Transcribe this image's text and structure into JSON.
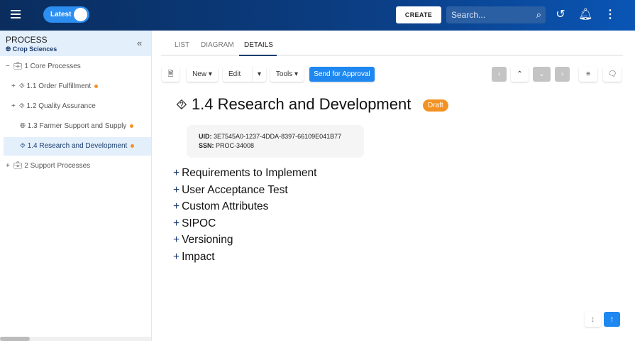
{
  "header": {
    "toggle_label": "Latest",
    "create_label": "CREATE",
    "search_placeholder": "Search..."
  },
  "sidebar": {
    "title": "PROCESS",
    "subtitle": "Crop Sciences",
    "items": [
      {
        "label": "1 Core Processes",
        "expander": "−",
        "icon": "briefcase-icon",
        "dot": false
      },
      {
        "label": "1.1 Order Fulfillment",
        "expander": "+",
        "icon": "process-flow-icon",
        "dot": true
      },
      {
        "label": "1.2 Quality Assurance",
        "expander": "+",
        "icon": "process-flow-icon",
        "dot": false
      },
      {
        "label": "1.3 Farmer Support and Supply",
        "expander": "",
        "icon": "globe-icon",
        "dot": true
      },
      {
        "label": "1.4 Research and Development",
        "expander": "",
        "icon": "process-flow-icon",
        "dot": true,
        "selected": true
      },
      {
        "label": "2 Support Processes",
        "expander": "+",
        "icon": "briefcase-icon",
        "dot": false
      }
    ]
  },
  "tabs": [
    {
      "label": "LIST"
    },
    {
      "label": "DIAGRAM"
    },
    {
      "label": "DETAILS",
      "active": true
    }
  ],
  "toolbar": {
    "new_label": "New",
    "edit_label": "Edit",
    "tools_label": "Tools",
    "approval_label": "Send for Approval"
  },
  "details": {
    "title": "1.4 Research and Development",
    "status": "Draft",
    "uid_label": "UID:",
    "uid": "3E7545A0-1237-4DDA-8397-66109E041B77",
    "ssn_label": "SSN:",
    "ssn": "PROC-34008",
    "sections": [
      "Requirements to Implement",
      "User Acceptance Test",
      "Custom Attributes",
      "SIPOC",
      "Versioning",
      "Impact"
    ]
  },
  "colors": {
    "header": "#0b3f86",
    "accent": "#1e88f0",
    "draft": "#f39222",
    "selected_bg": "#e3effb"
  }
}
